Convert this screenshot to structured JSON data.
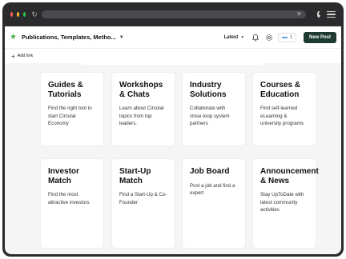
{
  "browser": {
    "dot_colors": [
      "#ff5f57",
      "#febc2e",
      "#28c840"
    ]
  },
  "app": {
    "workspace_title": "Publications, Templates, Metho...",
    "sort_label": "Latest",
    "new_post_label": "New Post",
    "add_link_label": "Add link",
    "accent_color": "#1f3b30",
    "star_color": "#4caf50"
  },
  "cards": [
    {
      "title": "Guides & Tutorials",
      "description": "Find the right tool to start Circular Economy"
    },
    {
      "title": "Workshops & Chats",
      "description": "Learn about Circular topics from top leaders."
    },
    {
      "title": "Industry Solutions",
      "description": "Collaborate with close-loop system partners"
    },
    {
      "title": "Courses & Education",
      "description": "Find self-learned eLearning & university programs"
    },
    {
      "title": "Investor Match",
      "description": "Find the most attractive investors"
    },
    {
      "title": "Start-Up Match",
      "description": "Find a Start-Up & Co-Founder"
    },
    {
      "title": "Job Board",
      "description": "Post a job and find a expert"
    },
    {
      "title": "Announcement & News",
      "description": "Stay UpToDate with latest community activities"
    }
  ]
}
